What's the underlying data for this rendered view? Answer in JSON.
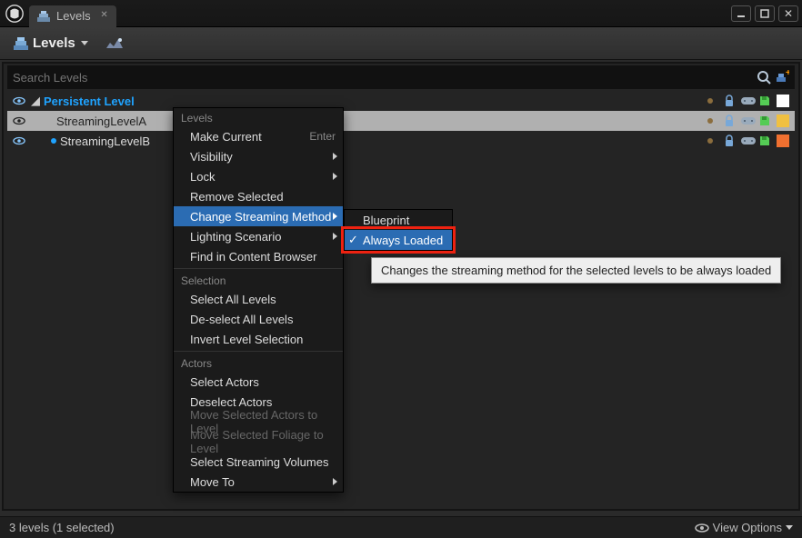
{
  "window": {
    "tab_title": "Levels"
  },
  "toolbar": {
    "levels_label": "Levels"
  },
  "search": {
    "placeholder": "Search Levels"
  },
  "tree": {
    "persistent": {
      "label": "Persistent Level"
    },
    "rows": [
      {
        "label": "StreamingLevelA",
        "selected": true,
        "dot": "",
        "color": "#f0c040"
      },
      {
        "label": "StreamingLevelB",
        "selected": false,
        "dot": "#1fa3ff",
        "color": "#f07030"
      }
    ]
  },
  "ctx": {
    "groups": {
      "levels": "Levels",
      "selection": "Selection",
      "actors": "Actors"
    },
    "items": {
      "make_current": "Make Current",
      "make_current_sc": "Enter",
      "visibility": "Visibility",
      "lock": "Lock",
      "remove_selected": "Remove Selected",
      "change_streaming": "Change Streaming Method",
      "lighting_scenario": "Lighting Scenario",
      "find_cb": "Find in Content Browser",
      "select_all": "Select All Levels",
      "deselect_all": "De-select All Levels",
      "invert": "Invert Level Selection",
      "select_actors": "Select Actors",
      "deselect_actors": "Deselect Actors",
      "move_actors": "Move Selected Actors to Level",
      "move_foliage": "Move Selected Foliage to Level",
      "select_volumes": "Select Streaming Volumes",
      "move_to": "Move To"
    }
  },
  "submenu": {
    "blueprint": "Blueprint",
    "always_loaded": "Always Loaded"
  },
  "tooltip": "Changes the streaming method for the selected levels to be always loaded",
  "status": {
    "left": "3 levels (1 selected)",
    "view_options": "View Options"
  }
}
